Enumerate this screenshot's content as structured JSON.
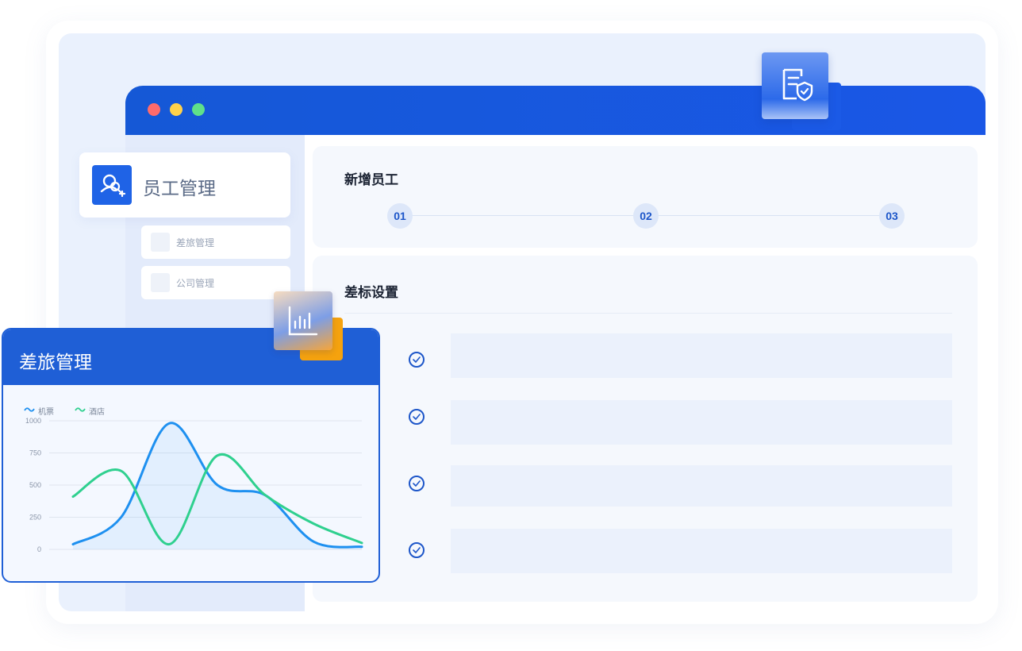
{
  "window": {
    "traffic_lights": [
      "red",
      "yellow",
      "green"
    ]
  },
  "sidebar": {
    "main_item": {
      "label": "员工管理",
      "icon": "user-add-icon"
    },
    "items": [
      {
        "label": "差旅管理"
      },
      {
        "label": "公司管理"
      }
    ]
  },
  "new_employee": {
    "title": "新增员工",
    "steps": [
      "01",
      "02",
      "03"
    ]
  },
  "biao_settings": {
    "title": "差标设置",
    "rows": 4
  },
  "travel_card": {
    "title": "差旅管理",
    "icon": "bar-chart-icon"
  },
  "floating_icons": {
    "document": "document-shield-icon",
    "chart": "bar-chart-icon"
  },
  "colors": {
    "accent": "#1a57e6",
    "series_1": "#1e90f0",
    "series_2": "#2fd08f"
  },
  "chart_data": {
    "type": "line",
    "title": "",
    "ylim": [
      0,
      1000
    ],
    "yticks": [
      "0",
      "250",
      "500",
      "750",
      "1000"
    ],
    "x": [
      0,
      1,
      2,
      3,
      4,
      5,
      6
    ],
    "series": [
      {
        "name": "机票",
        "values": [
          40,
          250,
          980,
          500,
          420,
          60,
          20
        ]
      },
      {
        "name": "酒店",
        "values": [
          410,
          610,
          40,
          730,
          420,
          200,
          50
        ]
      }
    ],
    "legend": "top-left",
    "grid": true
  }
}
